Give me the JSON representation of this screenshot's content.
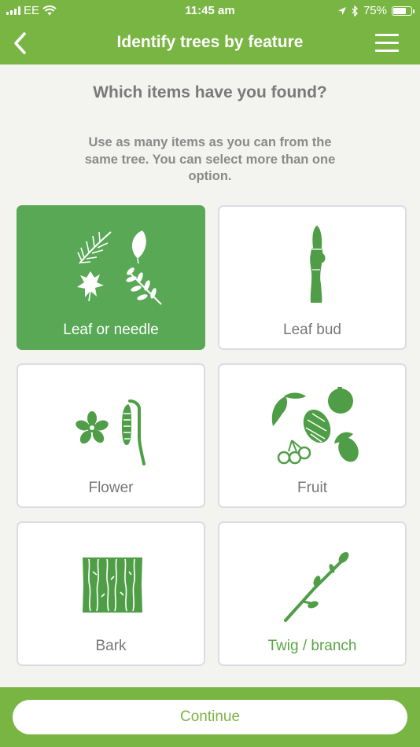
{
  "status_bar": {
    "carrier": "EE",
    "time": "11:45 am",
    "battery_percent": "75%",
    "battery_level": 0.75
  },
  "header": {
    "title": "Identify trees by feature"
  },
  "question": "Which items have you found?",
  "instructions": "Use as many items as you can from the same tree. You can select more than one option.",
  "options": [
    {
      "label": "Leaf or needle",
      "icon": "leaf-needle-icon",
      "selected": true
    },
    {
      "label": "Leaf bud",
      "icon": "leaf-bud-icon",
      "selected": false
    },
    {
      "label": "Flower",
      "icon": "flower-icon",
      "selected": false
    },
    {
      "label": "Fruit",
      "icon": "fruit-icon",
      "selected": false
    },
    {
      "label": "Bark",
      "icon": "bark-icon",
      "selected": false
    },
    {
      "label": "Twig / branch",
      "icon": "twig-icon",
      "selected": false
    }
  ],
  "continue_label": "Continue",
  "colors": {
    "brand": "#79b543",
    "selected": "#58a855",
    "icon_green": "#4f9e47",
    "text_gray": "#7a7a7a"
  }
}
